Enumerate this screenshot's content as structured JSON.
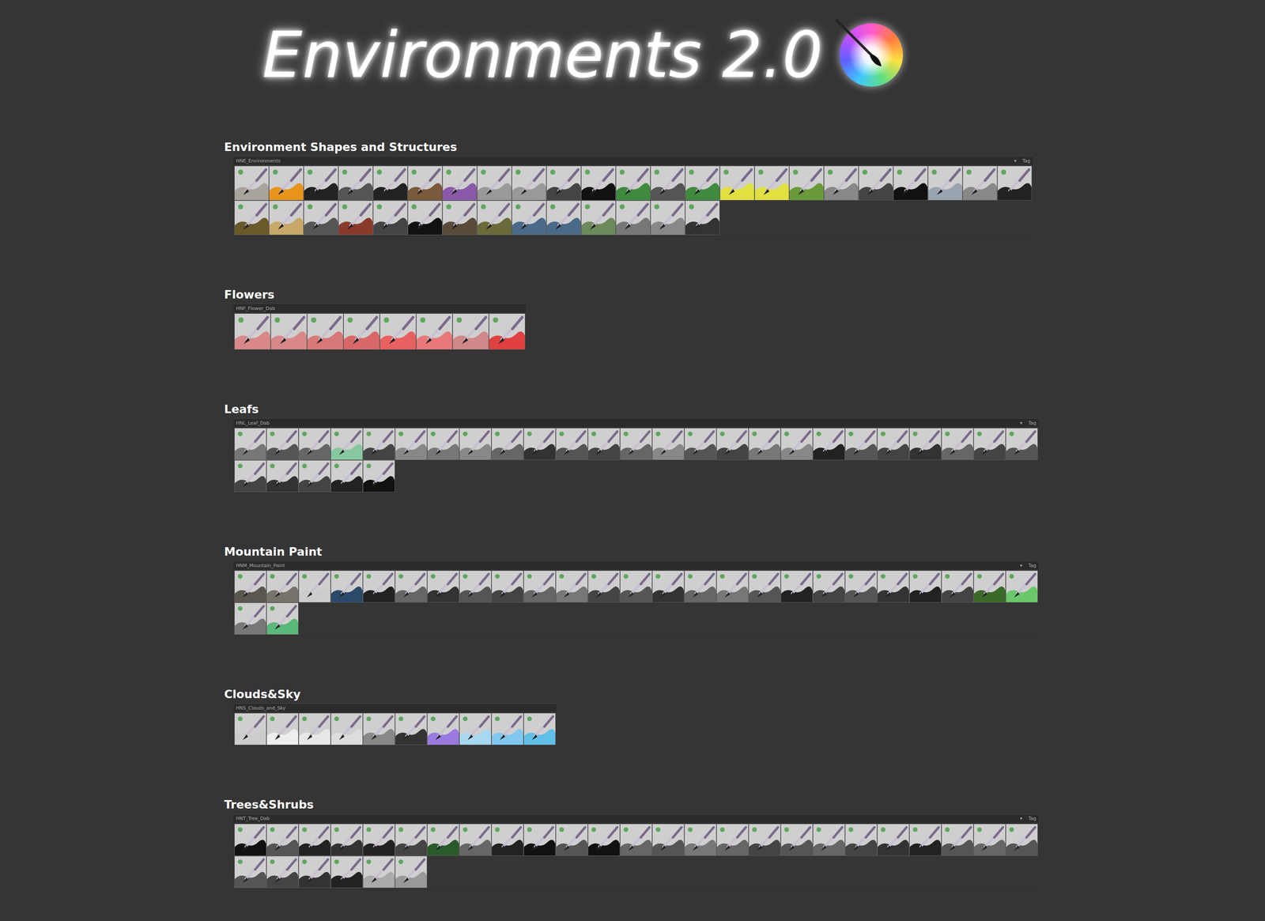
{
  "header": {
    "title": "Environments 2.0"
  },
  "sections": [
    {
      "title": "Environment Shapes and Structures",
      "bar": {
        "label": "HNE_Environments",
        "arrow": "▾",
        "tag": "Tag"
      },
      "tiles": [
        {
          "color": "#a8a49c"
        },
        {
          "color": "#e8941a"
        },
        {
          "color": "#222222"
        },
        {
          "color": "#555555"
        },
        {
          "color": "#222222"
        },
        {
          "color": "#7a5a3a"
        },
        {
          "color": "#8a5aa8"
        },
        {
          "color": "#999999"
        },
        {
          "color": "#999999"
        },
        {
          "color": "#444444"
        },
        {
          "color": "#111111"
        },
        {
          "color": "#3f8a3f"
        },
        {
          "color": "#555555"
        },
        {
          "color": "#3f8a3f"
        },
        {
          "color": "#e0e040"
        },
        {
          "color": "#e0e040"
        },
        {
          "color": "#6a9a3a"
        },
        {
          "color": "#888888"
        },
        {
          "color": "#444444"
        },
        {
          "color": "#111111"
        },
        {
          "color": "#9aa4b0"
        },
        {
          "color": "#888888"
        },
        {
          "color": "#222222"
        },
        {
          "color": "#6a5a2a"
        },
        {
          "color": "#c8a868"
        },
        {
          "color": "#555555"
        },
        {
          "color": "#8a3a2a"
        },
        {
          "color": "#444444"
        },
        {
          "color": "#111111"
        },
        {
          "color": "#5a4a3a"
        },
        {
          "color": "#6a6a3a"
        },
        {
          "color": "#4a6a8a"
        },
        {
          "color": "#4a6a8a"
        },
        {
          "color": "#6a8a5a"
        },
        {
          "color": "#777777"
        },
        {
          "color": "#888888"
        },
        {
          "color": "#333333"
        }
      ]
    },
    {
      "title": "Flowers",
      "bar": {
        "label": "HNF_Flower_Dab"
      },
      "tiles": [
        {
          "color": "#d88888"
        },
        {
          "color": "#d88888"
        },
        {
          "color": "#d87878"
        },
        {
          "color": "#d86868"
        },
        {
          "color": "#e86060"
        },
        {
          "color": "#e87878"
        },
        {
          "color": "#d08888"
        },
        {
          "color": "#e04040"
        }
      ]
    },
    {
      "title": "Leafs",
      "bar": {
        "label": "HNL_Leaf_Dab",
        "arrow": "▾",
        "tag": "Tag"
      },
      "tiles": [
        {
          "color": "#777777"
        },
        {
          "color": "#555555"
        },
        {
          "color": "#666666"
        },
        {
          "color": "#88c8a0"
        },
        {
          "color": "#444444"
        },
        {
          "color": "#888888"
        },
        {
          "color": "#777777"
        },
        {
          "color": "#888888"
        },
        {
          "color": "#666666"
        },
        {
          "color": "#333333"
        },
        {
          "color": "#555555"
        },
        {
          "color": "#444444"
        },
        {
          "color": "#666666"
        },
        {
          "color": "#888888"
        },
        {
          "color": "#555555"
        },
        {
          "color": "#444444"
        },
        {
          "color": "#777777"
        },
        {
          "color": "#888888"
        },
        {
          "color": "#222222"
        },
        {
          "color": "#555555"
        },
        {
          "color": "#444444"
        },
        {
          "color": "#333333"
        },
        {
          "color": "#666666"
        },
        {
          "color": "#444444"
        },
        {
          "color": "#555555"
        },
        {
          "color": "#444444"
        },
        {
          "color": "#333333"
        },
        {
          "color": "#444444"
        },
        {
          "color": "#222222"
        },
        {
          "color": "#111111"
        }
      ]
    },
    {
      "title": "Mountain Paint",
      "bar": {
        "label": "HNM_Mountain_Paint",
        "arrow": "▾",
        "tag": "Tag"
      },
      "tiles": [
        {
          "color": "#5a5650"
        },
        {
          "color": "#77736a"
        },
        {
          "color": "#cccccc"
        },
        {
          "color": "#2a4a6a"
        },
        {
          "color": "#222222"
        },
        {
          "color": "#666666"
        },
        {
          "color": "#333333"
        },
        {
          "color": "#555555"
        },
        {
          "color": "#444444"
        },
        {
          "color": "#666666"
        },
        {
          "color": "#777777"
        },
        {
          "color": "#444444"
        },
        {
          "color": "#555555"
        },
        {
          "color": "#333333"
        },
        {
          "color": "#666666"
        },
        {
          "color": "#777777"
        },
        {
          "color": "#555555"
        },
        {
          "color": "#222222"
        },
        {
          "color": "#444444"
        },
        {
          "color": "#555555"
        },
        {
          "color": "#333333"
        },
        {
          "color": "#222222"
        },
        {
          "color": "#444444"
        },
        {
          "color": "#3a6a2a"
        },
        {
          "color": "#6ac86a"
        },
        {
          "color": "#777777"
        },
        {
          "color": "#5ab87a"
        }
      ]
    },
    {
      "title": "Clouds&Sky",
      "bar": {
        "label": "HNS_Clouds_and_Sky"
      },
      "tiles": [
        {
          "color": "#cccccc"
        },
        {
          "color": "#eeeeee"
        },
        {
          "color": "#e8e8e8"
        },
        {
          "color": "#dddddd"
        },
        {
          "color": "#888888"
        },
        {
          "color": "#333333"
        },
        {
          "color": "#9a7ae0"
        },
        {
          "color": "#a8d8f0"
        },
        {
          "color": "#80c8f0"
        },
        {
          "color": "#60c0e8"
        }
      ]
    },
    {
      "title": "Trees&Shrubs",
      "bar": {
        "label": "HNT_Tree_Dab",
        "arrow": "▾",
        "tag": "Tag"
      },
      "tiles": [
        {
          "color": "#111111"
        },
        {
          "color": "#555555"
        },
        {
          "color": "#222222"
        },
        {
          "color": "#333333"
        },
        {
          "color": "#222222"
        },
        {
          "color": "#444444"
        },
        {
          "color": "#2a5a2a"
        },
        {
          "color": "#666666"
        },
        {
          "color": "#222222"
        },
        {
          "color": "#111111"
        },
        {
          "color": "#555555"
        },
        {
          "color": "#111111"
        },
        {
          "color": "#666666"
        },
        {
          "color": "#555555"
        },
        {
          "color": "#777777"
        },
        {
          "color": "#666666"
        },
        {
          "color": "#444444"
        },
        {
          "color": "#555555"
        },
        {
          "color": "#666666"
        },
        {
          "color": "#444444"
        },
        {
          "color": "#333333"
        },
        {
          "color": "#222222"
        },
        {
          "color": "#555555"
        },
        {
          "color": "#666666"
        },
        {
          "color": "#555555"
        },
        {
          "color": "#555555"
        },
        {
          "color": "#444444"
        },
        {
          "color": "#333333"
        },
        {
          "color": "#222222"
        },
        {
          "color": "#aaaaaa"
        },
        {
          "color": "#999999"
        }
      ]
    }
  ]
}
